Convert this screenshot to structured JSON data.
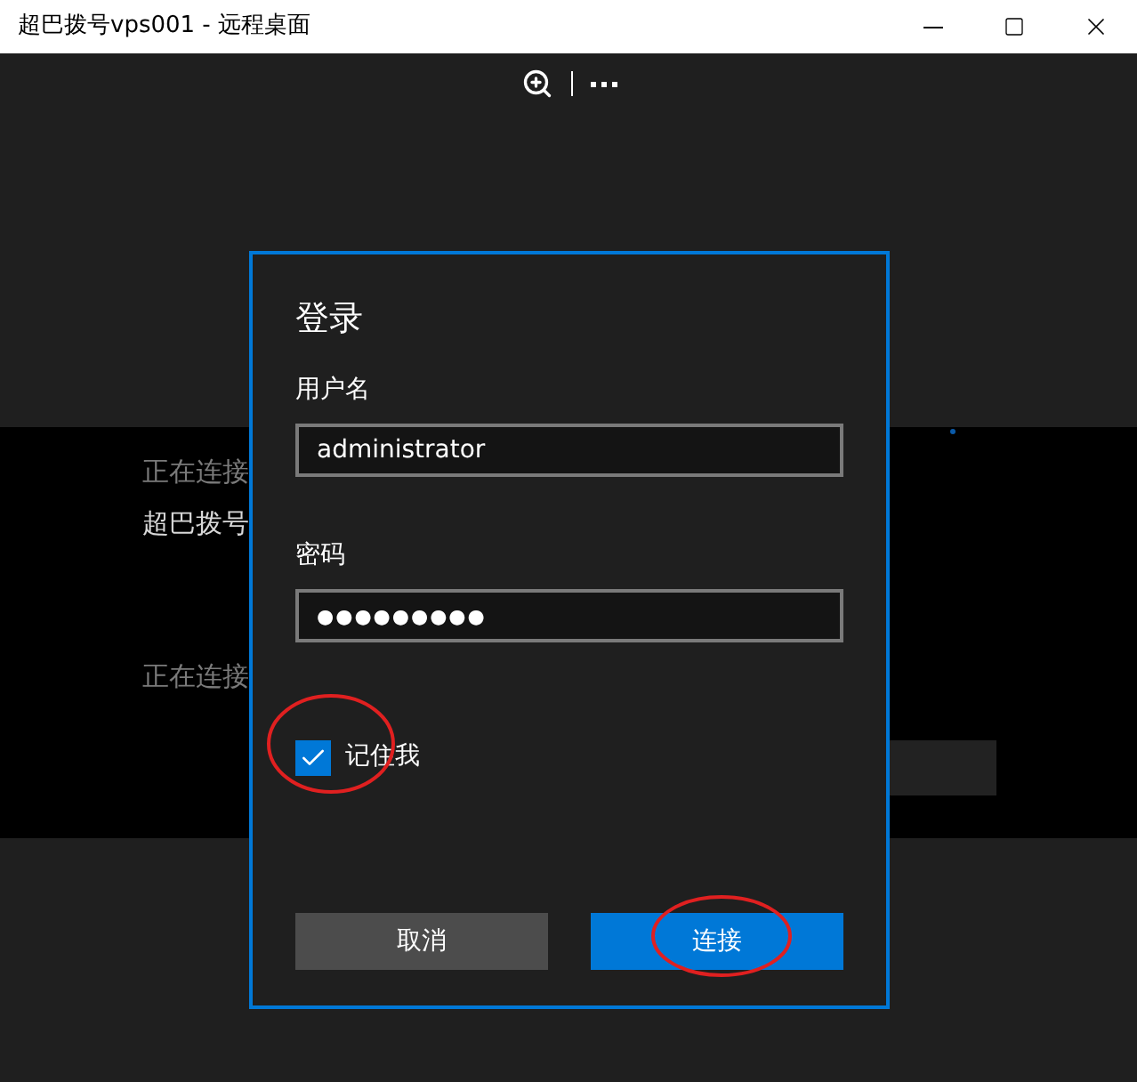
{
  "window": {
    "title": "超巴拨号vps001 - 远程桌面"
  },
  "background": {
    "status_1": "正在连接",
    "host": "超巴拨号",
    "status_2": "正在连接"
  },
  "dialog": {
    "title": "登录",
    "username_label": "用户名",
    "username": "administrator",
    "password_label": "密码",
    "password": "●●●●●●●●●",
    "remember": {
      "label": "记住我",
      "checked": true
    },
    "buttons": [
      {
        "label": "取消",
        "primary": false
      },
      {
        "label": "连接",
        "primary": true
      }
    ]
  }
}
